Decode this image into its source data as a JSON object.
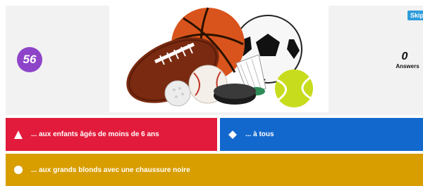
{
  "timer": {
    "value": "56"
  },
  "skip_label": "Skip",
  "answers": {
    "count": "0",
    "label": "Answers"
  },
  "image": {
    "alt": "sports-balls"
  },
  "choices": [
    {
      "shape": "triangle",
      "color": "#e21b3c",
      "text": "... aux enfants âgés de moins de 6 ans"
    },
    {
      "shape": "diamond",
      "color": "#1368ce",
      "text": "... à tous"
    },
    {
      "shape": "circle",
      "color": "#d89e00",
      "text": "... aux grands blonds avec une chaussure noire"
    }
  ]
}
